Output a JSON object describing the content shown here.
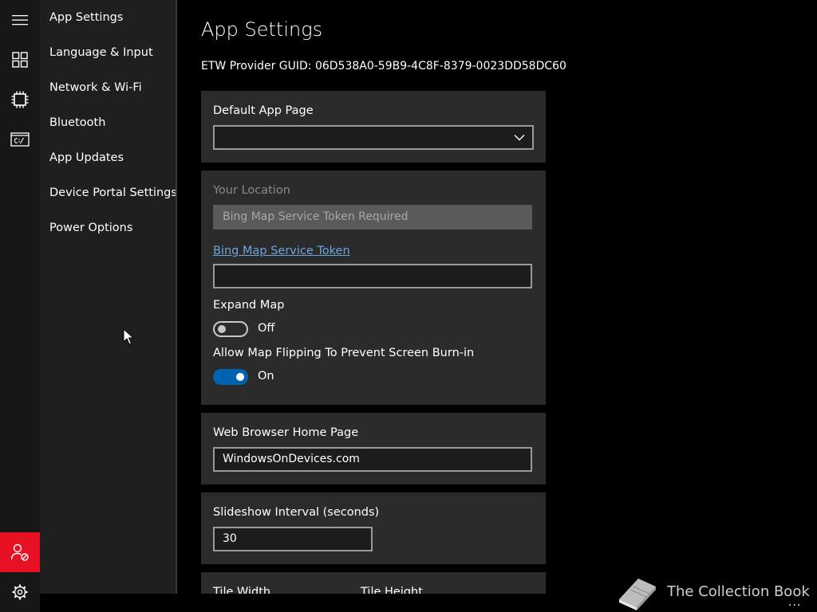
{
  "colors": {
    "rail_bg": "#171717",
    "nav_bg": "#1f1f1f",
    "card_bg": "#2b2b2b",
    "accent": "#0063b1",
    "alert": "#e81123",
    "link": "#6aa5e0"
  },
  "rail": {
    "icons": [
      "hamburger-menu-icon",
      "tiles-icon",
      "chip-icon",
      "command-prompt-icon",
      "user-blocked-icon",
      "gear-icon"
    ]
  },
  "nav": {
    "items": [
      {
        "label": "App Settings"
      },
      {
        "label": "Language & Input"
      },
      {
        "label": "Network & Wi-Fi"
      },
      {
        "label": "Bluetooth"
      },
      {
        "label": "App Updates"
      },
      {
        "label": "Device Portal Settings"
      },
      {
        "label": "Power Options"
      }
    ]
  },
  "main": {
    "title": "App Settings",
    "guid": "ETW Provider GUID: 06D538A0-59B9-4C8F-8379-0023DD58DC60",
    "default_app_page": {
      "label": "Default App Page",
      "value": ""
    },
    "location": {
      "label": "Your Location",
      "value": "Bing Map Service Token Required",
      "token_link": "Bing Map Service Token",
      "token_value": "",
      "expand_map": {
        "label": "Expand Map",
        "state": "Off",
        "on": false
      },
      "map_flip": {
        "label": "Allow Map Flipping To Prevent Screen Burn-in",
        "state": "On",
        "on": true
      }
    },
    "browser": {
      "label": "Web Browser Home Page",
      "value": "WindowsOnDevices.com"
    },
    "slideshow": {
      "label": "Slideshow Interval (seconds)",
      "value": "30"
    },
    "tiles": {
      "width_label": "Tile Width",
      "height_label": "Tile Height"
    }
  },
  "watermark": {
    "text": "The Collection Book",
    "icon": "book-icon"
  },
  "more": "..."
}
